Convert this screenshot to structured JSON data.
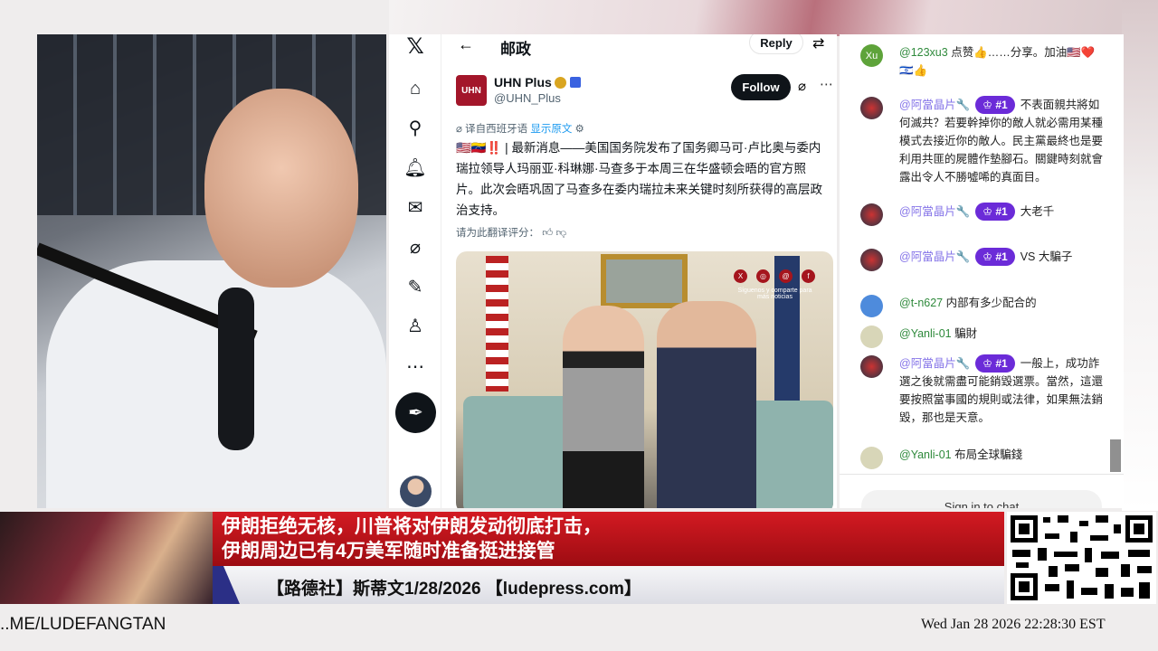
{
  "twitter": {
    "header_title": "邮政",
    "reply_label": "Reply",
    "post": {
      "avatar_text": "UHN",
      "name": "UHN Plus",
      "handle": "@UHN_Plus",
      "follow_label": "Follow",
      "translated_from": "译自西班牙语",
      "show_original": "显示原文",
      "flags": "🇺🇸🇻🇪‼️ | ",
      "text": "最新消息——美国国务院发布了国务卿马可·卢比奥与委内瑞拉领导人玛丽亚·科琳娜·马查多于本周三在华盛顿会晤的官方照片。此次会晤巩固了马查多在委内瑞拉未来关键时刻所获得的高层政治支持。",
      "rate_label": "请为此翻译评分：",
      "image_overlay": "Síguenos y comparte para más noticias"
    }
  },
  "chat": {
    "messages": [
      {
        "user": "@123xu3",
        "text": "点赞👍……分享。加油🇺🇸❤️🇮🇱👍",
        "avatar": "Xu"
      },
      {
        "user": "@阿當晶片🔧",
        "badge": "#1",
        "text": "不表面親共將如何滅共？若要幹掉你的敵人就必需用某種模式去接近你的敵人。民主黨最終也是要利用共匪的屍體作墊腳石。關鍵時刻就會露出令人不勝噓唏的真面目。"
      },
      {
        "user": "@阿當晶片🔧",
        "badge": "#1",
        "text": "大老千"
      },
      {
        "user": "@阿當晶片🔧",
        "badge": "#1",
        "text": "VS 大騙子"
      },
      {
        "user": "@t-n627",
        "text": "内部有多少配合的"
      },
      {
        "user": "@Yanli-01",
        "text": "騙財"
      },
      {
        "user": "@阿當晶片🔧",
        "badge": "#1",
        "text": "一般上，成功詐選之後就需盡可能銷毀選票。當然，這還要按照當事國的規則或法律，如果無法銷毀，那也是天意。"
      },
      {
        "user": "@Yanli-01",
        "text": "布局全球騙錢"
      }
    ],
    "sign_in_label": "Sign in to chat"
  },
  "banner": {
    "headline_1": "伊朗拒绝无核，川普将对伊朗发动彻底打击，",
    "headline_2": "伊朗周边已有4万美军随时准备挺进接管",
    "byline": "【路德社】斯蒂文1/28/2026 【ludepress.com】"
  },
  "footer": {
    "link": "..ME/LUDEFANGTAN",
    "datetime": "Wed Jan 28 2026 22:28:30 EST"
  }
}
